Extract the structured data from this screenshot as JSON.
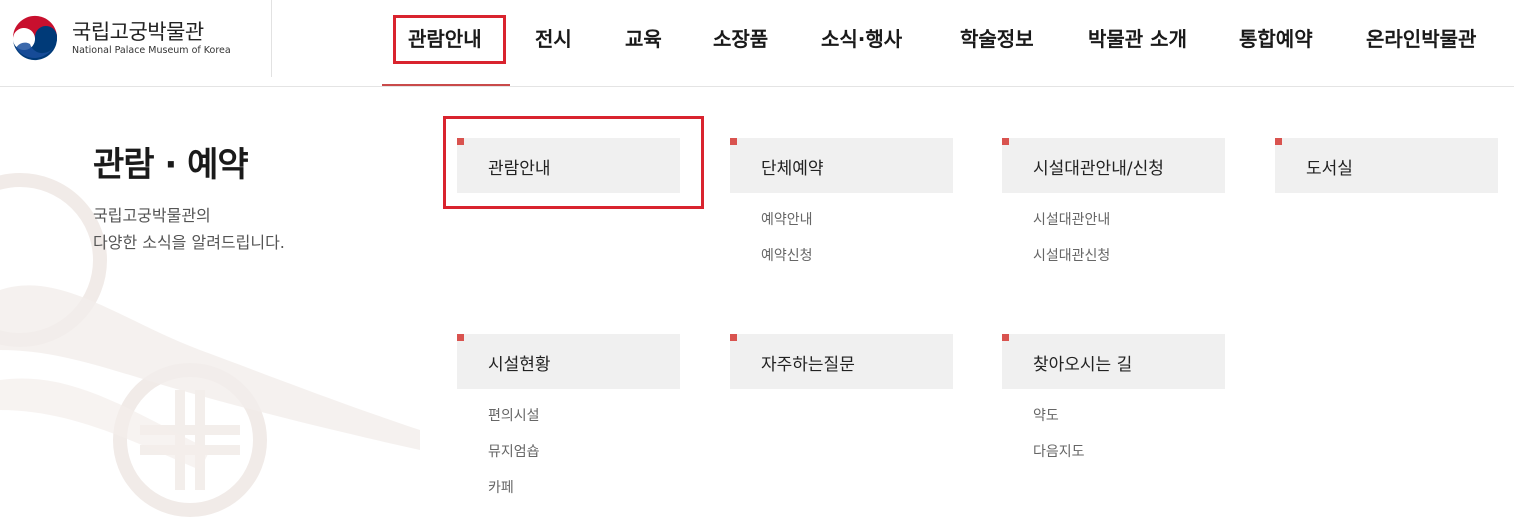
{
  "logo": {
    "name": "국립고궁박물관",
    "english": "National Palace Museum of Korea"
  },
  "nav": {
    "items": [
      {
        "label": "관람안내",
        "active": true
      },
      {
        "label": "전시"
      },
      {
        "label": "교육"
      },
      {
        "label": "소장품"
      },
      {
        "label": "소식·행사"
      },
      {
        "label": "학술정보"
      },
      {
        "label": "박물관 소개"
      },
      {
        "label": "통합예약"
      },
      {
        "label": "온라인박물관"
      }
    ],
    "highlight_color": "#d9232e"
  },
  "intro": {
    "title": "관람 · 예약",
    "desc_line1": "국립고궁박물관의",
    "desc_line2": "다양한 소식을 알려드립니다."
  },
  "panels": [
    {
      "title": "관람안내",
      "links": [],
      "highlighted": true
    },
    {
      "title": "단체예약",
      "links": [
        "예약안내",
        "예약신청"
      ]
    },
    {
      "title": "시설대관안내/신청",
      "links": [
        "시설대관안내",
        "시설대관신청"
      ]
    },
    {
      "title": "도서실",
      "links": []
    },
    {
      "title": "시설현황",
      "links": [
        "편의시설",
        "뮤지엄숍",
        "카페"
      ]
    },
    {
      "title": "자주하는질문",
      "links": []
    },
    {
      "title": "찾아오시는 길",
      "links": [
        "약도",
        "다음지도"
      ]
    }
  ],
  "colors": {
    "accent": "#d9534f",
    "panel_bg": "#f0f0f0"
  }
}
